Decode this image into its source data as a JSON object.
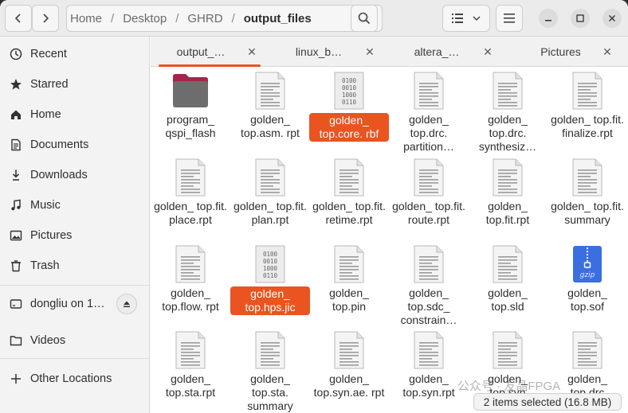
{
  "header": {
    "back_icon": "chevron-left-icon",
    "forward_icon": "chevron-right-icon",
    "breadcrumbs": [
      "Home",
      "Desktop",
      "GHRD",
      "output_files"
    ],
    "breadcrumb_separator": "/",
    "search_icon": "search-icon",
    "view_icon": "list-view-icon",
    "menu_icon": "hamburger-icon"
  },
  "sidebar": {
    "items": [
      {
        "label": "Recent",
        "icon": "clock-icon"
      },
      {
        "label": "Starred",
        "icon": "star-icon"
      },
      {
        "label": "Home",
        "icon": "home-icon"
      },
      {
        "label": "Documents",
        "icon": "document-icon"
      },
      {
        "label": "Downloads",
        "icon": "download-icon"
      },
      {
        "label": "Music",
        "icon": "music-icon"
      },
      {
        "label": "Pictures",
        "icon": "picture-icon"
      },
      {
        "label": "Trash",
        "icon": "trash-icon"
      }
    ],
    "mount": {
      "label": "dongliu on 1…",
      "icon": "drive-icon"
    },
    "videos": {
      "label": "Videos",
      "icon": "folder-icon"
    },
    "other_locations": {
      "label": "Other Locations",
      "icon": "plus-icon"
    }
  },
  "tabs": [
    {
      "label": "output_…",
      "active": true
    },
    {
      "label": "linux_b…",
      "active": false
    },
    {
      "label": "altera_…",
      "active": false
    },
    {
      "label": "Pictures",
      "active": false
    }
  ],
  "files": [
    {
      "label": "program_ qspi_flash",
      "type": "folder",
      "selected": false
    },
    {
      "label": "golden_ top.asm. rpt",
      "type": "text",
      "selected": false
    },
    {
      "label": "golden_ top.core. rbf",
      "type": "binary",
      "selected": true
    },
    {
      "label": "golden_ top.drc. partition…",
      "type": "text",
      "selected": false
    },
    {
      "label": "golden_ top.drc. synthesiz…",
      "type": "text",
      "selected": false
    },
    {
      "label": "golden_ top.fit. finalize.rpt",
      "type": "text",
      "selected": false
    },
    {
      "label": "golden_ top.fit. place.rpt",
      "type": "text",
      "selected": false
    },
    {
      "label": "golden_ top.fit. plan.rpt",
      "type": "text",
      "selected": false
    },
    {
      "label": "golden_ top.fit. retime.rpt",
      "type": "text",
      "selected": false
    },
    {
      "label": "golden_ top.fit. route.rpt",
      "type": "text",
      "selected": false
    },
    {
      "label": "golden_ top.fit.rpt",
      "type": "text",
      "selected": false
    },
    {
      "label": "golden_ top.fit. summary",
      "type": "text",
      "selected": false
    },
    {
      "label": "golden_ top.flow. rpt",
      "type": "text",
      "selected": false
    },
    {
      "label": "golden_ top.hps.jic",
      "type": "binary",
      "selected": true
    },
    {
      "label": "golden_ top.pin",
      "type": "text",
      "selected": false
    },
    {
      "label": "golden_ top.sdc_ constrain…",
      "type": "text",
      "selected": false
    },
    {
      "label": "golden_ top.sld",
      "type": "text",
      "selected": false
    },
    {
      "label": "golden_ top.sof",
      "type": "gzip",
      "selected": false
    },
    {
      "label": "golden_ top.sta.rpt",
      "type": "text",
      "selected": false
    },
    {
      "label": "golden_ top.sta. summary",
      "type": "text",
      "selected": false
    },
    {
      "label": "golden_ top.syn.ae. rpt",
      "type": "text",
      "selected": false
    },
    {
      "label": "golden_ top.syn.rpt",
      "type": "text",
      "selected": false
    },
    {
      "label": "golden_ top.syn",
      "type": "text",
      "selected": false
    },
    {
      "label": "golden_ top.drc",
      "type": "text",
      "selected": false
    }
  ],
  "binary_icon_text": [
    "0100",
    "0010",
    "1000",
    "0110"
  ],
  "gzip_icon_text": "gzip",
  "status": "2 items selected (16.8 MB)",
  "watermark": "公众号 · 友晶FPGA",
  "colors": {
    "accent": "#e95420",
    "folder": "#6d6d6d",
    "folder_tab": "#a4254a",
    "gzip": "#3b6fe0"
  }
}
